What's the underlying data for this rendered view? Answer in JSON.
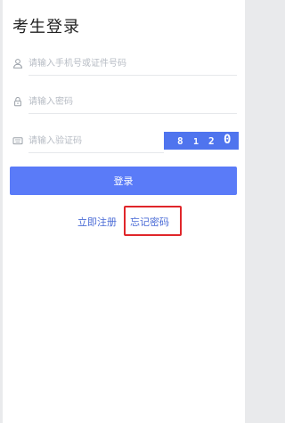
{
  "page": {
    "title": "考生登录"
  },
  "form": {
    "phone_placeholder": "请输入手机号或证件号码",
    "password_placeholder": "请输入密码",
    "code_placeholder": "请输入验证码",
    "captcha_digits": [
      "8",
      "1",
      "2",
      "0"
    ],
    "login_label": "登录"
  },
  "links": {
    "register": "立即注册",
    "forgot_password": "忘记密码"
  },
  "icons": {
    "phone_field": "user-icon",
    "password_field": "lock-icon",
    "code_field": "keyboard-icon"
  },
  "colors": {
    "primary": "#5a7bf8",
    "captcha_bg": "#4f74ee",
    "link": "#4a6bd6",
    "highlight": "#e0262a",
    "background": "#e9eaec"
  }
}
